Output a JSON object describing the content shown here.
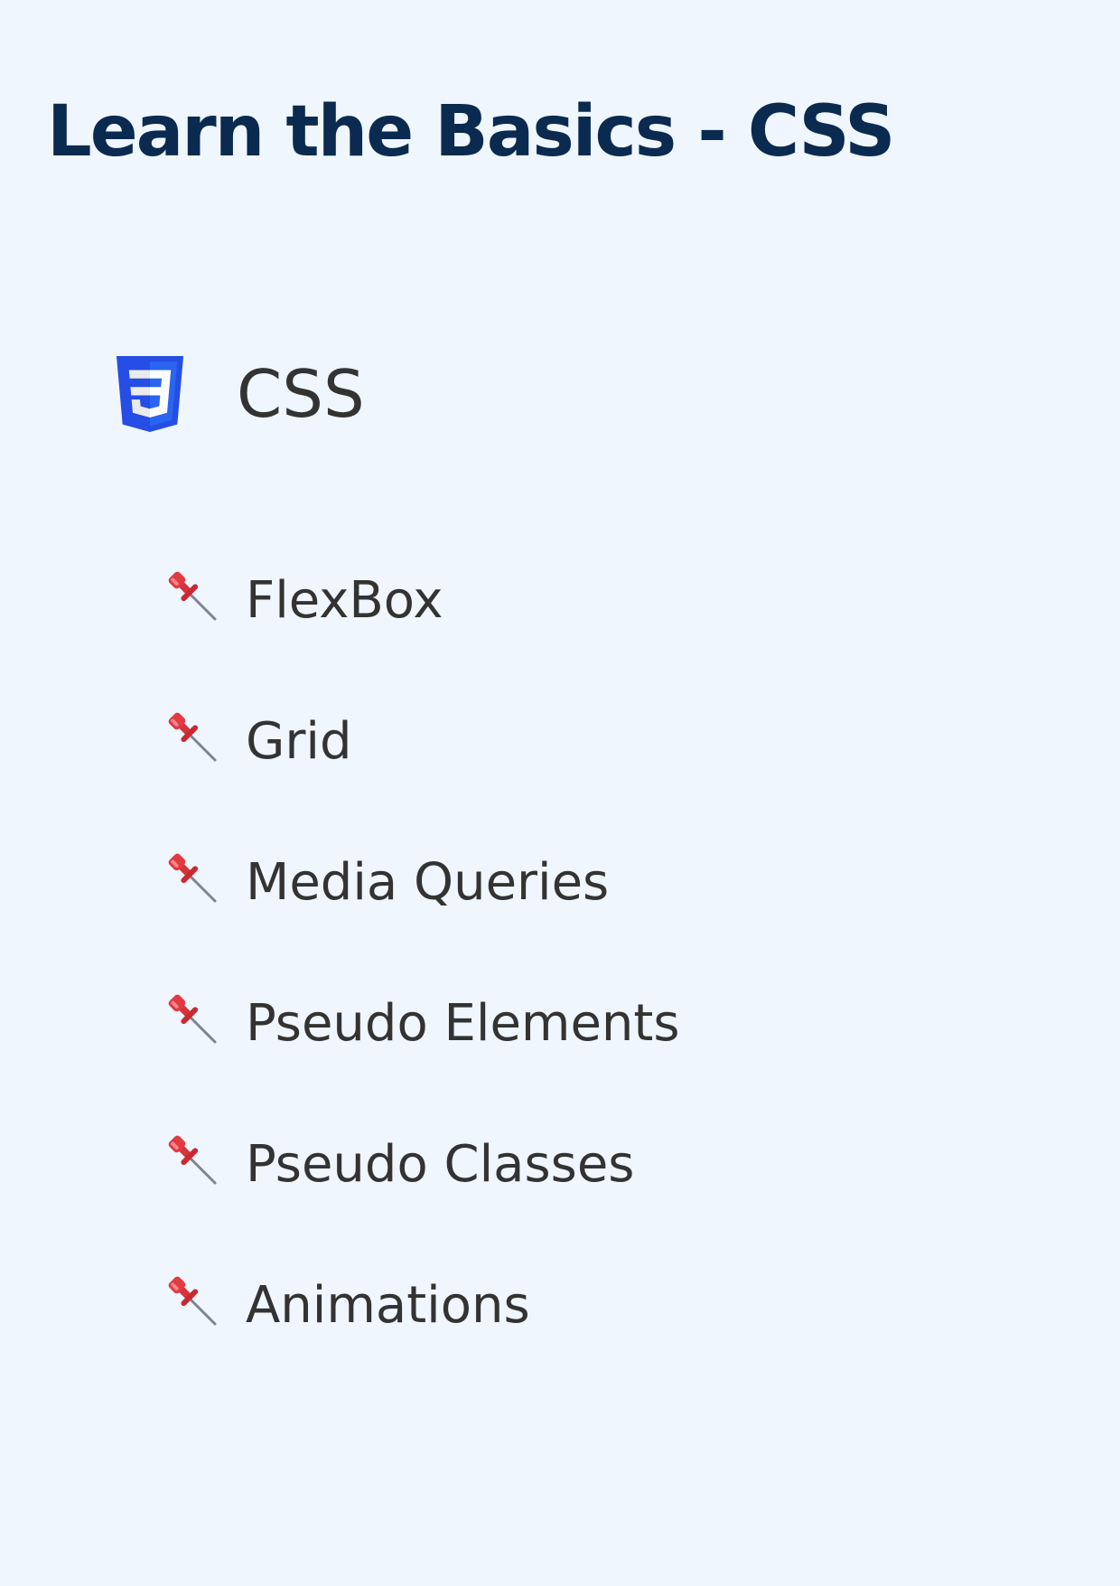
{
  "page": {
    "title": "Learn the Basics - CSS",
    "background_color": "#eff6fe",
    "title_color": "#0b2a4f",
    "text_color": "#333333"
  },
  "section": {
    "label": "CSS",
    "icon": "css3-logo-icon",
    "logo_colors": [
      "#264de4",
      "#2965f1",
      "#ebebeb",
      "#ffffff"
    ]
  },
  "topics": [
    {
      "label": "FlexBox",
      "icon": "pushpin-icon"
    },
    {
      "label": "Grid",
      "icon": "pushpin-icon"
    },
    {
      "label": "Media Queries",
      "icon": "pushpin-icon"
    },
    {
      "label": "Pseudo Elements",
      "icon": "pushpin-icon"
    },
    {
      "label": "Pseudo Classes",
      "icon": "pushpin-icon"
    },
    {
      "label": "Animations",
      "icon": "pushpin-icon"
    }
  ]
}
